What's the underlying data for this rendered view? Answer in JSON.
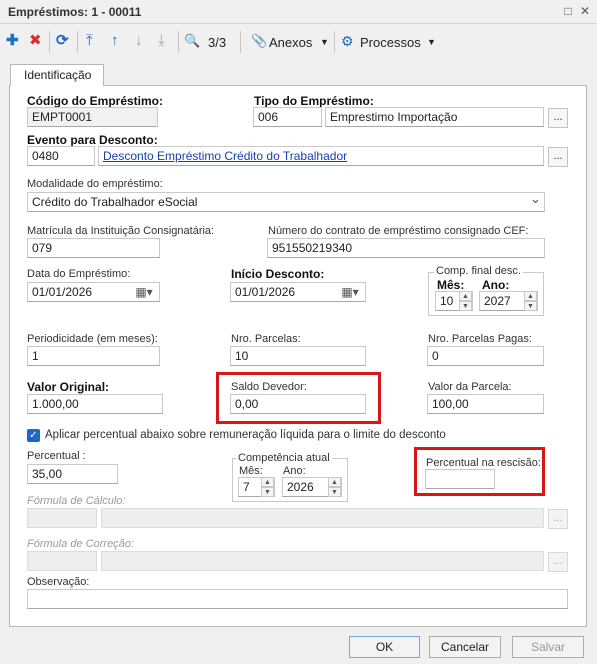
{
  "window": {
    "title": "Empréstimos: 1 - 00011",
    "restore_glyph": "□",
    "close_glyph": "✕"
  },
  "toolbar": {
    "record_counter": "3/3",
    "anexos_label": "Anexos",
    "processos_label": "Processos",
    "dropdown_glyph": "▼"
  },
  "icons": {
    "add": "✚",
    "delete": "✖",
    "refresh": "⟳",
    "first": "⤒",
    "prev": "↑",
    "next": "↓",
    "last": "⤓",
    "search": "🔍",
    "attach": "📎",
    "gear": "⚙",
    "calendar": "▦▾",
    "spin_up": "▲",
    "spin_down": "▼",
    "select_caret": "⌄",
    "checkmark": "✓"
  },
  "colors": {
    "accent": "#1f67c2",
    "highlight_border": "#d5161a",
    "add": "#1a73c7",
    "delete": "#d32f2f"
  },
  "tabs": [
    {
      "label": "Identificação"
    }
  ],
  "form": {
    "codigo": {
      "label": "Código do Empréstimo:",
      "value": "EMPT0001"
    },
    "tipo": {
      "label": "Tipo do Empréstimo:",
      "code": "006",
      "description": "Emprestimo Importação"
    },
    "evento": {
      "label": "Evento para Desconto:",
      "code": "0480",
      "description": "Desconto Empréstimo Crédito do Trabalhador"
    },
    "modalidade": {
      "label": "Modalidade do empréstimo:",
      "value": "Crédito do Trabalhador eSocial"
    },
    "matricula": {
      "label": "Matrícula da Instituição Consignatária:",
      "value": "079"
    },
    "contrato": {
      "label": "Número do contrato de empréstimo consignado CEF:",
      "value": "951550219340"
    },
    "data_emprestimo": {
      "label": "Data do Empréstimo:",
      "value": "01/01/2026"
    },
    "inicio_desconto": {
      "label": "Início Desconto:",
      "value": "01/01/2026"
    },
    "comp_final": {
      "label": "Comp. final desc.",
      "mes_label": "Mês:",
      "ano_label": "Ano:",
      "mes": "10",
      "ano": "2027"
    },
    "periodicidade": {
      "label": "Periodicidade (em meses):",
      "value": "1"
    },
    "nro_parcelas": {
      "label": "Nro. Parcelas:",
      "value": "10"
    },
    "nro_parcelas_pagas": {
      "label": "Nro. Parcelas Pagas:",
      "value": "0"
    },
    "valor_original": {
      "label": "Valor Original:",
      "value": "1.000,00"
    },
    "saldo_devedor": {
      "label": "Saldo Devedor:",
      "value": "0,00"
    },
    "valor_parcela": {
      "label": "Valor da Parcela:",
      "value": "100,00"
    },
    "aplicar_percentual": {
      "label": "Aplicar percentual abaixo sobre remuneração líquida para o limite do desconto",
      "checked": true
    },
    "percentual": {
      "label": "Percentual :",
      "value": "35,00"
    },
    "competencia_atual": {
      "label": "Competência atual",
      "mes_label": "Mês:",
      "ano_label": "Ano:",
      "mes": "7",
      "ano": "2026"
    },
    "percentual_rescisao": {
      "label": "Percentual na rescisão:",
      "value": ""
    },
    "formula_calculo": {
      "label": "Fórmula de Cálculo:"
    },
    "formula_correcao": {
      "label": "Fórmula de Correção:"
    },
    "observacao": {
      "label": "Observação:",
      "value": ""
    },
    "lookup_button": "..."
  },
  "footer": {
    "ok_label": "OK",
    "cancel_label": "Cancelar",
    "save_label": "Salvar"
  }
}
